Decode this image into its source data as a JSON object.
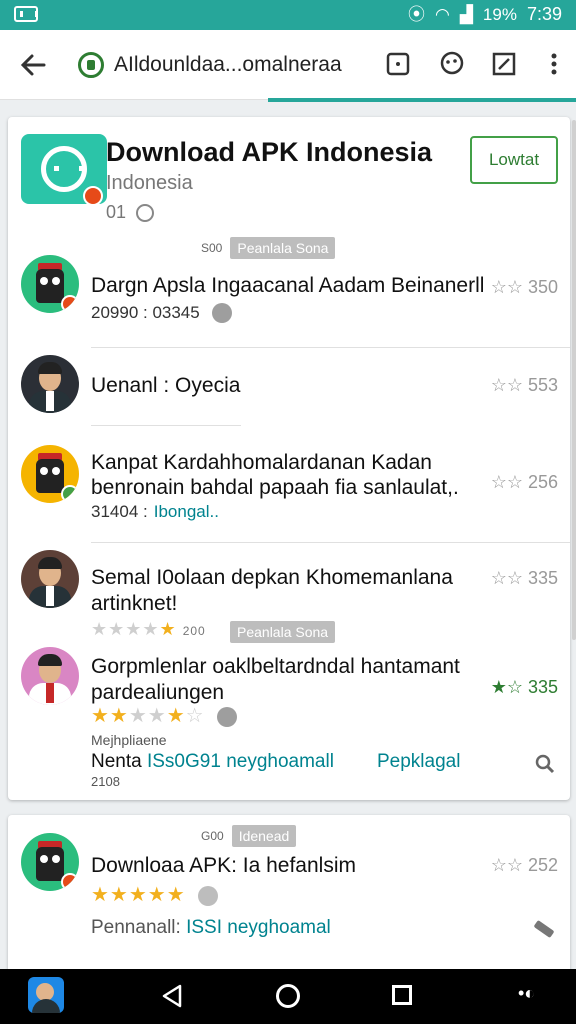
{
  "status_bar": {
    "battery": "19%",
    "time": "7:39"
  },
  "browser": {
    "url": "AIldounldaa...omalneraa"
  },
  "colors": {
    "accent": "#26a69a",
    "install": "#2e7d32",
    "link": "#00838f",
    "star": "#f2b01e"
  },
  "header_card": {
    "title": "Download APK Indonesia",
    "subtitle": "Indonesia",
    "meta": "01",
    "install_label": "Lowtat",
    "tag_small": "S00",
    "tag_chip": "Peanlala Sona"
  },
  "rows": [
    {
      "title": "Dargn Apsla Ingaacanal Aadam Beinanerll",
      "sub": "20990 : 03345",
      "rating": "☆☆ 350"
    },
    {
      "title": "Uenanl : Oyecia",
      "rating": "☆☆ 553"
    },
    {
      "title_line1": "Kanpat Kardahhomalardanan Kadan",
      "title_line2": "benronain bahdal papaah fia sanlaulat,.",
      "sub_prefix": "31404 :",
      "sub_link": "Ibongal..",
      "rating": "☆☆ 256"
    },
    {
      "title_line1": "Semal I0olaan depkan Khomemanlana",
      "title_line2": "artinknet!",
      "rating": "☆☆ 335",
      "stars_label": "200",
      "chip": "Peanlala Sona"
    },
    {
      "title_line1": "Gorpmlenlar oaklbeltardndal hantamant",
      "title_line2": "pardealiungen",
      "rating": "★☆ 335",
      "foot_small": "Mejhpliaene",
      "foot_prefix": "Nenta",
      "foot_link": "ISs0G91 neyghoamall",
      "foot_link2": "Pepklagal",
      "foot_num": "2108"
    }
  ],
  "second_card": {
    "tag_small": "G00",
    "tag_chip": "Idenead",
    "title": "Downloaa APK: Ia hefanlsim",
    "rating": "☆☆ 252",
    "foot_prefix": "Pennanall:",
    "foot_link": "ISSI neyghoamal"
  }
}
